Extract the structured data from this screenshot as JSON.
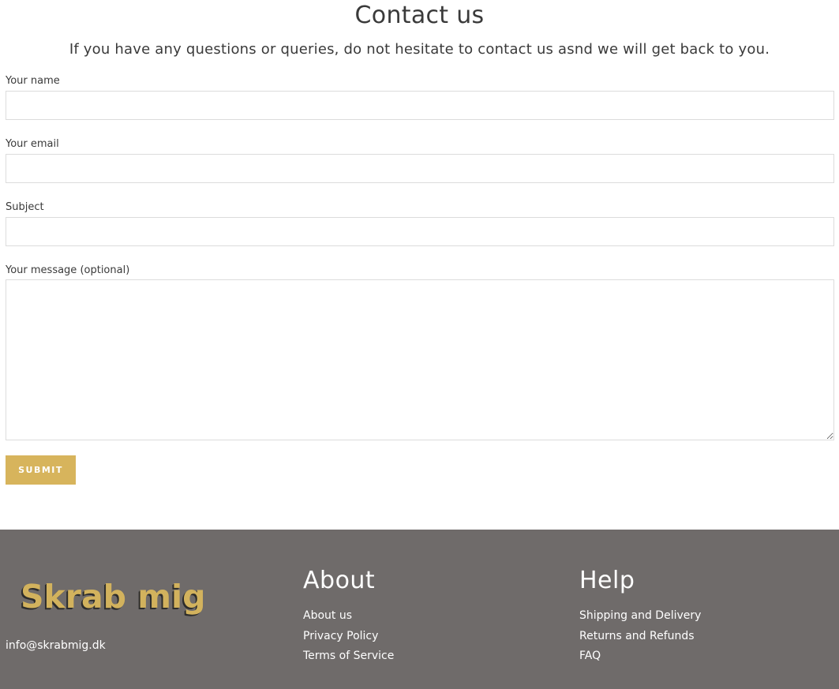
{
  "page": {
    "title": "Contact us",
    "intro": "If you have any questions or queries, do not hesitate to contact us asnd we will get back to you."
  },
  "form": {
    "name_label": "Your name",
    "name_value": "",
    "email_label": "Your email",
    "email_value": "",
    "subject_label": "Subject",
    "subject_value": "",
    "message_label": "Your message (optional)",
    "message_value": "",
    "submit_label": "SUBMIT"
  },
  "footer": {
    "brand": "Skrab mig",
    "email": "info@skrabmig.dk",
    "about": {
      "heading": "About",
      "links": [
        "About us",
        "Privacy Policy",
        "Terms of Service"
      ]
    },
    "help": {
      "heading": "Help",
      "links": [
        "Shipping and Delivery",
        "Returns and Refunds",
        "FAQ"
      ]
    }
  },
  "colors": {
    "accent": "#d7b45c",
    "footer_background": "#6f6b6a",
    "text": "#3a3a3a",
    "input_border": "#dcdcdc"
  }
}
